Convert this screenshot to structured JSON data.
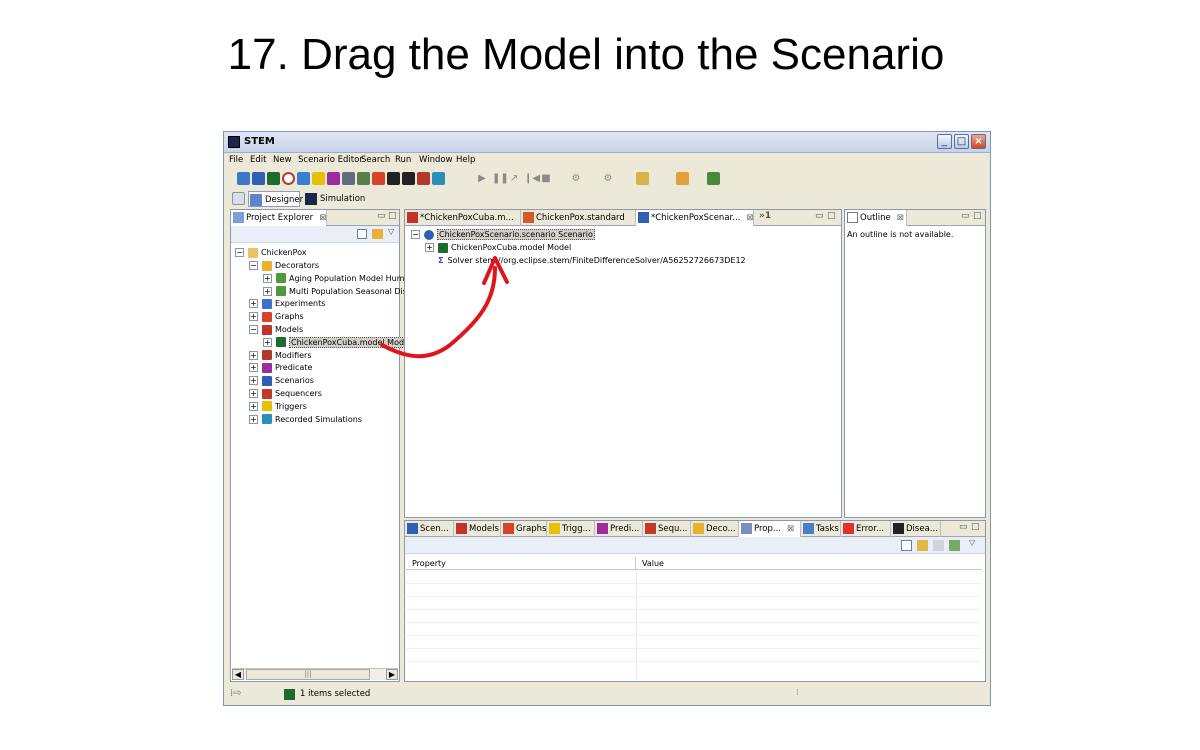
{
  "slide": {
    "title": "17. Drag the Model into the Scenario"
  },
  "window": {
    "title": "STEM",
    "buttons": {
      "minimize": "_",
      "maximize": "□",
      "close": "×"
    }
  },
  "menubar": [
    "File",
    "Edit",
    "New",
    "Scenario Editor",
    "Search",
    "Run",
    "Window",
    "Help"
  ],
  "perspectives": {
    "designer": "Designer",
    "simulation": "Simulation"
  },
  "explorer": {
    "tab_label": "Project Explorer",
    "project": "ChickenPox",
    "items": [
      {
        "label": "Decorators",
        "toggle": "⊟",
        "icon_color": "#e9b22d"
      },
      {
        "label": "Aging Population Model Human",
        "toggle": "⊞",
        "icon_color": "#4e9a3a",
        "child": true
      },
      {
        "label": "Multi Population Seasonal Dise",
        "toggle": "⊞",
        "icon_color": "#4e9a3a",
        "child": true
      },
      {
        "label": "Experiments",
        "toggle": "⊞",
        "icon_color": "#3d6fd1"
      },
      {
        "label": "Graphs",
        "toggle": "⊞",
        "icon_color": "#d6432b"
      },
      {
        "label": "Models",
        "toggle": "⊟",
        "icon_color": "#c2332b"
      },
      {
        "label": "ChickenPoxCuba.model Model",
        "toggle": "⊞",
        "icon_color": "#1f6b2e",
        "child": true,
        "selected": true
      },
      {
        "label": "Modifiers",
        "toggle": "⊞",
        "icon_color": "#b23a2a"
      },
      {
        "label": "Predicate",
        "toggle": "⊞",
        "icon_color": "#9b2c9b"
      },
      {
        "label": "Scenarios",
        "toggle": "⊞",
        "icon_color": "#2f5fb3"
      },
      {
        "label": "Sequencers",
        "toggle": "⊞",
        "icon_color": "#c0392b"
      },
      {
        "label": "Triggers",
        "toggle": "⊞",
        "icon_color": "#e5c100"
      },
      {
        "label": "Recorded Simulations",
        "toggle": "⊞",
        "icon_color": "#2a8fb8"
      }
    ]
  },
  "editor": {
    "tabs": [
      {
        "label": "*ChickenPoxCuba.m...",
        "icon_color": "#c2332b"
      },
      {
        "label": "ChickenPox.standard",
        "icon_color": "#d35a2b"
      },
      {
        "label": "*ChickenPoxScenar...",
        "icon_color": "#2f5fb3",
        "active": true,
        "close": "⊠"
      }
    ],
    "overflow": "»1",
    "tree": {
      "root": "ChickenPoxScenario.scenario Scenario",
      "model": "ChickenPoxCuba.model Model",
      "solver": "Solver stem://org.eclipse.stem/FiniteDifferenceSolver/A56252726673DE12",
      "solver_icon": "Σ"
    }
  },
  "outline": {
    "tab_label": "Outline",
    "message": "An outline is not available."
  },
  "bottom": {
    "tabs": [
      {
        "label": "Scen...",
        "icon_color": "#2f5fb3"
      },
      {
        "label": "Models",
        "icon_color": "#c2332b"
      },
      {
        "label": "Graphs",
        "icon_color": "#d6432b"
      },
      {
        "label": "Trigg...",
        "icon_color": "#e5c100"
      },
      {
        "label": "Predi...",
        "icon_color": "#9b2c9b"
      },
      {
        "label": "Sequ...",
        "icon_color": "#c0392b"
      },
      {
        "label": "Deco...",
        "icon_color": "#e9b22d"
      },
      {
        "label": "Prop...",
        "icon_color": "#7b8fb8",
        "active": true,
        "close": "⊠"
      },
      {
        "label": "Tasks",
        "icon_color": "#4a7fc7"
      },
      {
        "label": "Error...",
        "icon_color": "#d33"
      },
      {
        "label": "Disea...",
        "icon_color": "#222"
      }
    ],
    "columns": [
      "Property",
      "Value"
    ]
  },
  "status": {
    "text": "1 items selected"
  },
  "colors": {
    "arrow": "#e0141b",
    "selection": "#d4d0c8"
  }
}
